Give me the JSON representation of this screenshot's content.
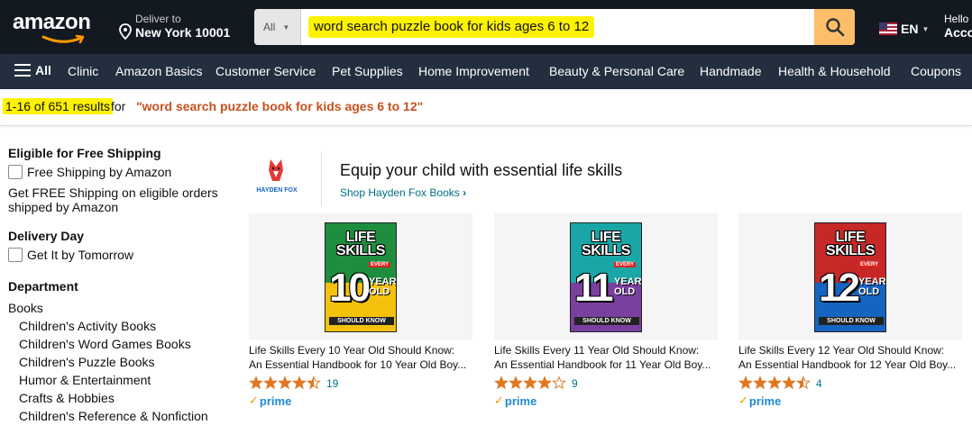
{
  "nav": {
    "logo": "amazon",
    "deliver_line1": "Deliver to",
    "deliver_line2": "New York 10001",
    "search_category": "All",
    "search_query": "word search puzzle book for kids ages 6 to 12",
    "lang": "EN",
    "account_line1": "Hello",
    "account_line2": "Acco"
  },
  "subnav": {
    "all": "All",
    "links": [
      "Clinic",
      "Amazon Basics",
      "Customer Service",
      "Pet Supplies",
      "Home Improvement",
      "Beauty & Personal Care",
      "Handmade",
      "Health & Household",
      "Coupons"
    ]
  },
  "results": {
    "count": "1-16 of 651 results",
    "for": "for",
    "query": "\"word search puzzle book for kids ages 6 to 12\""
  },
  "sidebar": {
    "free_shipping_heading": "Eligible for Free Shipping",
    "free_shipping_option": "Free Shipping by Amazon",
    "free_shipping_desc_1": "Get FREE Shipping on eligible orders",
    "free_shipping_desc_2": "shipped by Amazon",
    "delivery_heading": "Delivery Day",
    "delivery_option": "Get It by Tomorrow",
    "department_heading": "Department",
    "department_root": "Books",
    "departments": [
      "Children's Activity Books",
      "Children's Word Games Books",
      "Children's Puzzle Books",
      "Humor & Entertainment",
      "Crafts & Hobbies",
      "Children's Reference & Nonfiction"
    ]
  },
  "sponsored": {
    "brand_logo_text": "HAYDEN FOX",
    "headline": "Equip your child with essential life skills",
    "link": "Shop Hayden Fox Books"
  },
  "products": [
    {
      "cover_life": "LIFE",
      "cover_skills": "SKILLS",
      "cover_every": "EVERY",
      "cover_num": "10",
      "cover_year": "YEAR",
      "cover_old": "OLD",
      "cover_know": "SHOULD KNOW",
      "title_line1": "Life Skills Every 10 Year Old Should Know:",
      "title_line2": "An Essential Handbook for 10 Year Old Boy...",
      "rating": 4.5,
      "reviews": "19",
      "prime": "prime",
      "cover_colors": [
        "#1e8e3e",
        "#f4c20d"
      ]
    },
    {
      "cover_life": "LIFE",
      "cover_skills": "SKILLS",
      "cover_every": "EVERY",
      "cover_num": "11",
      "cover_year": "YEAR",
      "cover_old": "OLD",
      "cover_know": "SHOULD KNOW",
      "title_line1": "Life Skills Every 11 Year Old Should Know:",
      "title_line2": "An Essential Handbook for 11 Year Old Boy...",
      "rating": 4.0,
      "reviews": "9",
      "prime": "prime",
      "cover_colors": [
        "#1aa6a6",
        "#7b3fa0"
      ]
    },
    {
      "cover_life": "LIFE",
      "cover_skills": "SKILLS",
      "cover_every": "EVERY",
      "cover_num": "12",
      "cover_year": "YEAR",
      "cover_old": "OLD",
      "cover_know": "SHOULD KNOW",
      "title_line1": "Life Skills Every 12 Year Old Should Know:",
      "title_line2": "An Essential Handbook for 12 Year Old Boy...",
      "rating": 4.5,
      "reviews": "4",
      "prime": "prime",
      "cover_colors": [
        "#c62828",
        "#1565c0"
      ]
    }
  ],
  "colors": {
    "nav_bg": "#131921",
    "subnav_bg": "#232f3e",
    "search_button": "#febd69",
    "highlight": "#fff200",
    "query_orange": "#c7511f",
    "link_teal": "#007185",
    "star": "#de7921",
    "prime_blue": "#1f8ad2"
  }
}
